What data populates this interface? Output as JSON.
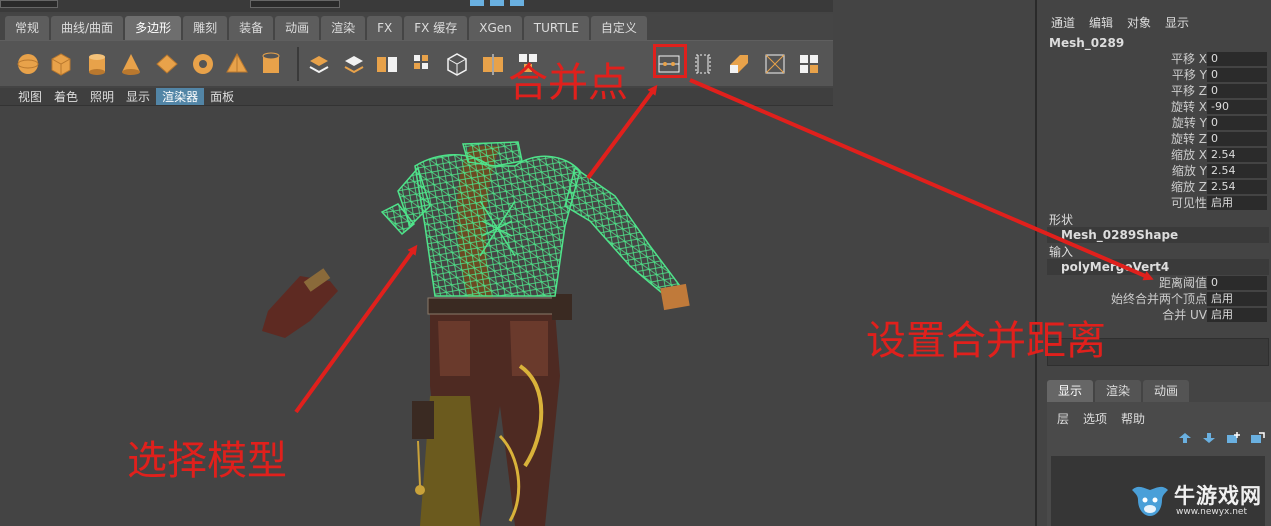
{
  "shelf_tabs": [
    {
      "label": "常规"
    },
    {
      "label": "曲线/曲面"
    },
    {
      "label": "多边形",
      "active": true
    },
    {
      "label": "雕刻"
    },
    {
      "label": "装备"
    },
    {
      "label": "动画"
    },
    {
      "label": "渲染"
    },
    {
      "label": "FX"
    },
    {
      "label": "FX 缓存"
    },
    {
      "label": "XGen"
    },
    {
      "label": "TURTLE"
    },
    {
      "label": "自定义"
    }
  ],
  "shelf_icons": [
    "sphere-icon",
    "cube-icon",
    "cylinder-icon",
    "cone-icon",
    "plane-icon",
    "torus-icon",
    "pyramid-icon",
    "pipe-icon",
    "combine-icon",
    "separate-icon",
    "extract-icon",
    "smooth-icon",
    "triangulate-icon",
    "mirror-icon",
    "bridge-icon",
    "merge-vertices-icon",
    "merge-edge-icon",
    "extrude-icon",
    "bevel-icon",
    "append-icon"
  ],
  "panel_menu": [
    {
      "label": "视图"
    },
    {
      "label": "着色"
    },
    {
      "label": "照明"
    },
    {
      "label": "显示"
    },
    {
      "label": "渲染器",
      "active": true
    },
    {
      "label": "面板"
    }
  ],
  "channel_box": {
    "menu": [
      "通道",
      "编辑",
      "对象",
      "显示"
    ],
    "node_name": "Mesh_0289",
    "attributes": [
      {
        "label": "平移 X",
        "value": "0"
      },
      {
        "label": "平移 Y",
        "value": "0"
      },
      {
        "label": "平移 Z",
        "value": "0"
      },
      {
        "label": "旋转 X",
        "value": "-90"
      },
      {
        "label": "旋转 Y",
        "value": "0"
      },
      {
        "label": "旋转 Z",
        "value": "0"
      },
      {
        "label": "缩放 X",
        "value": "2.54"
      },
      {
        "label": "缩放 Y",
        "value": "2.54"
      },
      {
        "label": "缩放 Z",
        "value": "2.54"
      },
      {
        "label": "可见性",
        "value": "启用"
      }
    ],
    "shape_header": "形状",
    "shape_name": "Mesh_0289Shape",
    "input_header": "输入",
    "input_name": "polyMergeVert4",
    "input_attributes": [
      {
        "label": "距离阈值",
        "value": "0"
      },
      {
        "label": "始终合并两个顶点",
        "value": "启用"
      },
      {
        "label": "合并 UV",
        "value": "启用"
      }
    ]
  },
  "layer_editor": {
    "tabs": [
      {
        "label": "显示",
        "active": true
      },
      {
        "label": "渲染"
      },
      {
        "label": "动画"
      }
    ],
    "menu": [
      "层",
      "选项",
      "帮助"
    ]
  },
  "annotations": {
    "merge_point": "合并点",
    "set_distance": "设置合并距离",
    "select_model": "选择模型"
  },
  "watermark": {
    "name": "牛游戏网",
    "url": "www.newyx.net"
  },
  "colors": {
    "annotation": "#e0201c",
    "wireframe": "#4fe38a",
    "active_tab": "#5285a6"
  }
}
